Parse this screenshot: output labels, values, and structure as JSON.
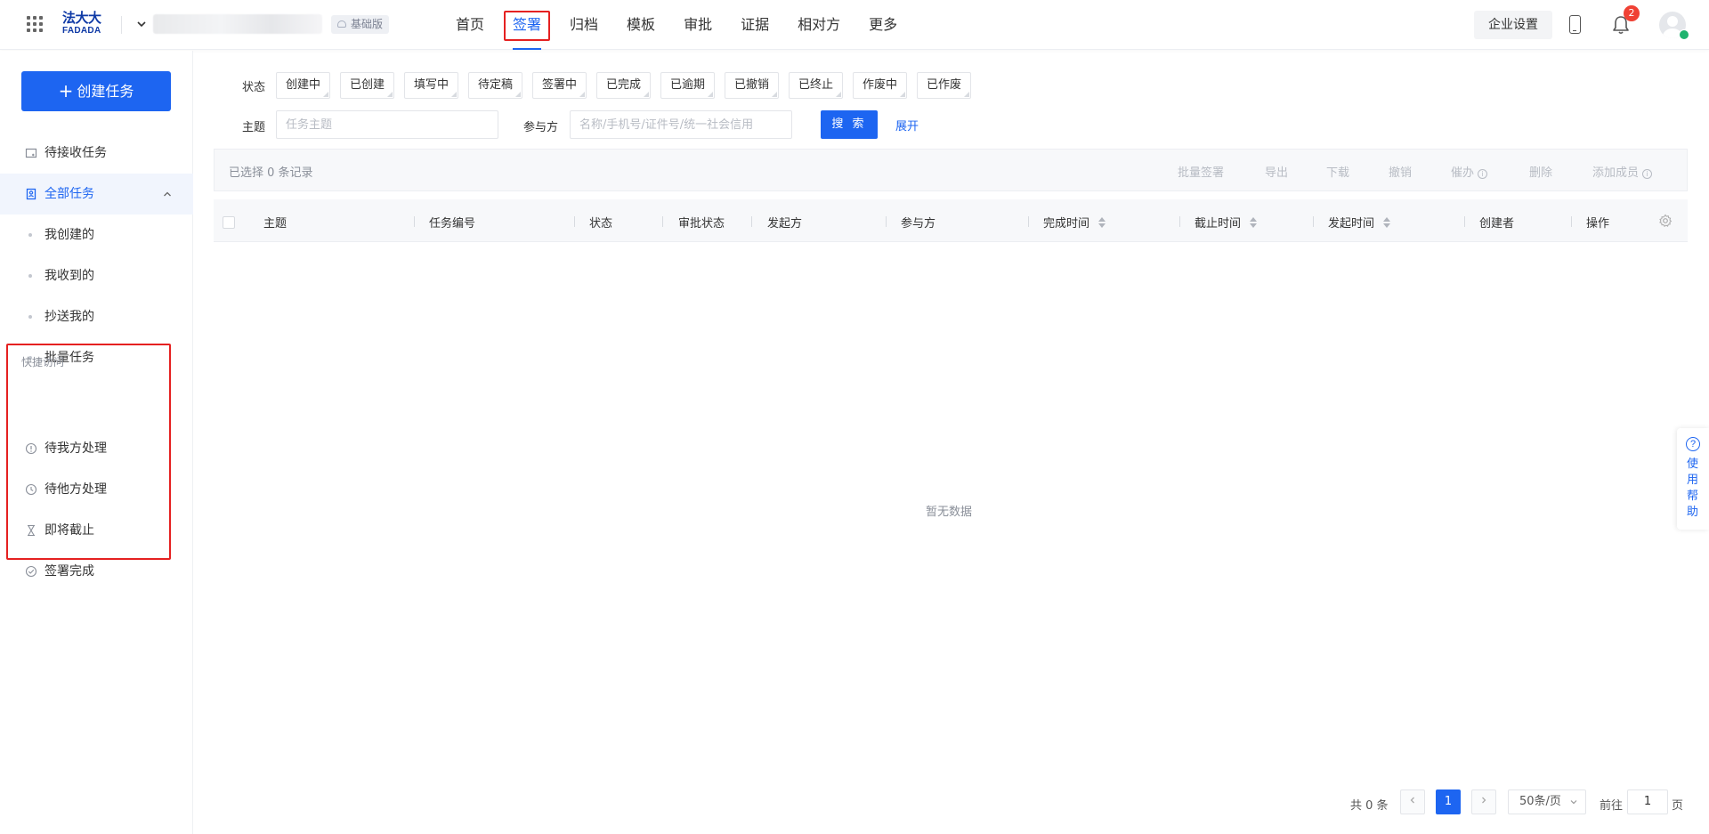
{
  "header": {
    "logo_cn": "法大大",
    "logo_en": "FADADA",
    "plan_badge": "基础版",
    "nav": [
      "首页",
      "签署",
      "归档",
      "模板",
      "审批",
      "证据",
      "相对方",
      "更多"
    ],
    "active_nav": "签署",
    "enterprise_settings": "企业设置",
    "notification_count": "2"
  },
  "sidebar": {
    "create_button": "创建任务",
    "items": {
      "pending_receive": "待接收任务",
      "all_tasks": "全部任务",
      "created_by_me": "我创建的",
      "received_by_me": "我收到的",
      "cc_me": "抄送我的",
      "batch_tasks": "批量任务"
    },
    "quick_access": {
      "title": "快捷访问",
      "items": [
        "待我方处理",
        "待他方处理",
        "即将截止",
        "签署完成"
      ]
    }
  },
  "filters": {
    "status_label": "状态",
    "statuses": [
      "创建中",
      "已创建",
      "填写中",
      "待定稿",
      "签署中",
      "已完成",
      "已逾期",
      "已撤销",
      "已终止",
      "作废中",
      "已作废"
    ],
    "subject_label": "主题",
    "subject_placeholder": "任务主题",
    "participant_label": "参与方",
    "participant_placeholder": "名称/手机号/证件号/统一社会信用",
    "search_button": "搜 索",
    "expand_link": "展开"
  },
  "action_bar": {
    "selected_text": "已选择 0 条记录",
    "actions": [
      "批量签署",
      "导出",
      "下载",
      "撤销",
      "催办",
      "删除",
      "添加成员"
    ]
  },
  "table": {
    "columns": [
      "主题",
      "任务编号",
      "状态",
      "审批状态",
      "发起方",
      "参与方",
      "完成时间",
      "截止时间",
      "发起时间",
      "创建者",
      "操作"
    ],
    "empty_text": "暂无数据"
  },
  "pagination": {
    "total": "共 0 条",
    "current_page": "1",
    "page_size": "50条/页",
    "goto_prefix": "前往",
    "goto_value": "1",
    "goto_suffix": "页"
  },
  "help_float": {
    "label": "使用帮助"
  },
  "colors": {
    "primary": "#1d65f1",
    "highlight_red": "#e52121",
    "badge_red": "#f04134"
  }
}
